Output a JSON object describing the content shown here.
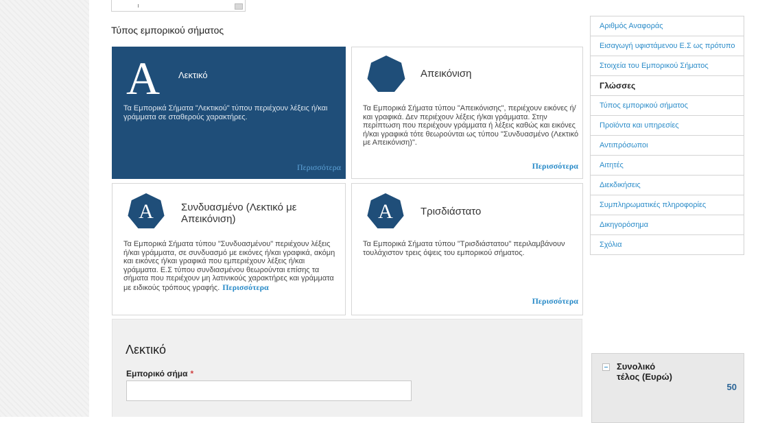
{
  "section_title": "Τύπος εμπορικού σήματος",
  "cards": [
    {
      "id": "word",
      "title": "Λεκτικό",
      "icon_letter": "A",
      "desc": "Τα Εμπορικά Σήματα \"Λεκτικού\" τύπου περιέχουν λέξεις ή/και γράμματα σε σταθερούς χαρακτήρες.",
      "more": "Περισσότερα"
    },
    {
      "id": "figurative",
      "title": "Απεικόνιση",
      "desc": "Τα Εμπορικά Σήματα τύπου \"Απεικόνισης\", περιέχουν εικόνες ή/και γραφικά. Δεν περιέχουν λέξεις ή/και γράμματα. Στην περίπτωση που περιέχουν γράμματα ή λέξεις καθώς και εικόνες ή/και γραφικά τότε θεωρούνται ως τύπου \"Συνδυασμένο (Λεκτικό με Απεικόνιση)\".",
      "more": "Περισσότερα"
    },
    {
      "id": "combined",
      "title": "Συνδυασμένο (Λεκτικό με Απεικόνιση)",
      "icon_letter": "A",
      "desc": "Τα Εμπορικά Σήματα τύπου \"Συνδυασμένου\" περιέχουν λέξεις ή/και γράμματα, σε συνδυασμό με εικόνες ή/και γραφικά, ακόμη και εικόνες ή/και γραφικά που εμπεριέχουν λέξεις ή/και γράμματα. Ε.Σ τύπου συνδιασμένου θεωρούνται επίσης τα σήματα που περιέχουν μη λατινικούς χαρακτήρες και γράμματα με ειδικούς τρόπους γραφής.",
      "more": "Περισσότερα"
    },
    {
      "id": "3d",
      "title": "Τρισδιάστατο",
      "icon_letter": "A",
      "desc": "Τα Εμπορικά Σήματα τύπου \"Τρισδιάστατου\" περιλαμβάνουν τουλάχιστον τρεις όψεις του εμπορικού σήματος.",
      "more": "Περισσότερα"
    }
  ],
  "form": {
    "title": "Λεκτικό",
    "label": "Εμπορικό σήμα",
    "required_mark": "*",
    "value": ""
  },
  "nav": {
    "items": [
      {
        "label": "Αριθμός Αναφοράς"
      },
      {
        "label": "Εισαγωγή υφιστάμενου Ε.Σ ως πρότυπο"
      },
      {
        "label": "Στοιχεία του Εμπορικού Σήματος"
      },
      {
        "label": "Γλώσσες",
        "current": true
      },
      {
        "label": "Τύπος εμπορικού σήματος"
      },
      {
        "label": "Προϊόντα και υπηρεσίες"
      },
      {
        "label": "Αντιπρόσωποι"
      },
      {
        "label": "Αιτητές"
      },
      {
        "label": "Διεκδικήσεις"
      },
      {
        "label": "Συμπληρωματικές πληροφορίες"
      },
      {
        "label": "Δικηγορόσημα"
      },
      {
        "label": "Σχόλια"
      }
    ]
  },
  "fee": {
    "label": "Συνολικό τέλος (Ευρώ)",
    "value": "50"
  },
  "colors": {
    "active_card": "#1f4e79",
    "link": "#2a8bc8",
    "required": "#d04040"
  }
}
